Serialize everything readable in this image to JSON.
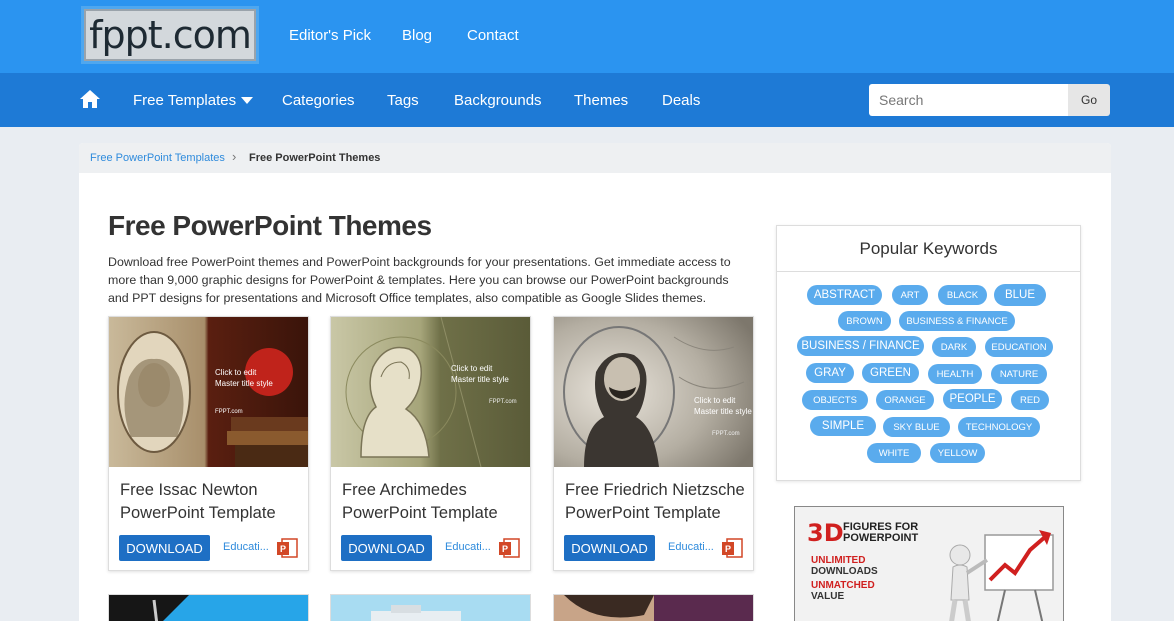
{
  "header": {
    "logo_text": "fppt.com",
    "top_links": [
      "Editor's Pick",
      "Blog",
      "Contact"
    ]
  },
  "nav": {
    "items": [
      "Free Templates",
      "Categories",
      "Tags",
      "Backgrounds",
      "Themes",
      "Deals"
    ],
    "search_placeholder": "Search",
    "go_label": "Go"
  },
  "breadcrumb": {
    "parent": "Free PowerPoint Templates",
    "separator": "›",
    "current": "Free PowerPoint Themes"
  },
  "page": {
    "title": "Free PowerPoint Themes",
    "description": "Download free PowerPoint themes and PowerPoint backgrounds for your presentations. Get immediate access to more than 9,000 graphic designs for PowerPoint & templates. Here you can browse our PowerPoint backgrounds and PPT designs for presentations and Microsoft Office templates, also compatible as Google Slides themes."
  },
  "cards": [
    {
      "title": "Free Issac Newton PowerPoint Template",
      "download": "DOWNLOAD",
      "category": "Educati...",
      "thumb_text": [
        "Click to edit",
        "Master title style",
        "FPPT.com"
      ]
    },
    {
      "title": "Free Archimedes PowerPoint Template",
      "download": "DOWNLOAD",
      "category": "Educati...",
      "thumb_text": [
        "Click to edit",
        "Master title style",
        "FPPT.com"
      ]
    },
    {
      "title": "Free Friedrich Nietzsche PowerPoint Template",
      "download": "DOWNLOAD",
      "category": "Educati...",
      "thumb_text": [
        "Click to edit",
        "Master title style",
        "FPPT.com"
      ]
    }
  ],
  "keywords": {
    "title": "Popular Keywords",
    "tags": [
      "ABSTRACT",
      "ART",
      "BLACK",
      "BLUE",
      "BROWN",
      "BUSINESS & FINANCE",
      "BUSINESS / FINANCE",
      "DARK",
      "EDUCATION",
      "GRAY",
      "GREEN",
      "HEALTH",
      "NATURE",
      "OBJECTS",
      "ORANGE",
      "PEOPLE",
      "RED",
      "SIMPLE",
      "SKY BLUE",
      "TECHNOLOGY",
      "WHITE",
      "YELLOW"
    ]
  },
  "ad": {
    "headline_3d": "3D",
    "headline_rest": [
      "FIGURES FOR",
      "POWERPOINT"
    ],
    "lines": [
      "UNLIMITED",
      "DOWNLOADS",
      "UNMATCHED",
      "VALUE"
    ]
  },
  "colors": {
    "topbar": "#2b94f0",
    "navbar": "#1e7ad6",
    "download_button": "#1e6fc4",
    "tag": "#5aabed"
  }
}
